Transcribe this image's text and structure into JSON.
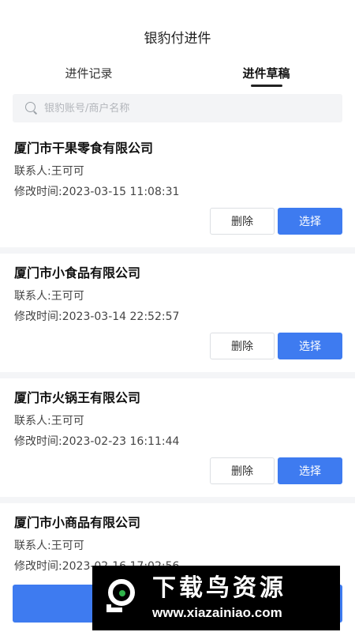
{
  "header": {
    "title": "银豹付进件"
  },
  "tabs": [
    {
      "label": "进件记录",
      "active": false
    },
    {
      "label": "进件草稿",
      "active": true
    }
  ],
  "search": {
    "placeholder": "银豹账号/商户名称",
    "value": ""
  },
  "records": [
    {
      "company": "厦门市干果零食有限公司",
      "contact": "联系人:王可可",
      "modified": "修改时间:2023-03-15 11:08:31",
      "delete_label": "删除",
      "select_label": "选择"
    },
    {
      "company": "厦门市小食品有限公司",
      "contact": "联系人:王可可",
      "modified": "修改时间:2023-03-14 22:52:57",
      "delete_label": "删除",
      "select_label": "选择"
    },
    {
      "company": "厦门市火锅王有限公司",
      "contact": "联系人:王可可",
      "modified": "修改时间:2023-02-23 16:11:44",
      "delete_label": "删除",
      "select_label": "选择"
    },
    {
      "company": "厦门市小商品有限公司",
      "contact": "联系人:王可可",
      "modified": "修改时间:2023-02-16 17:02:56"
    }
  ],
  "watermark": {
    "title": "下载鸟资源",
    "url": "www.xiazainiao.com"
  },
  "colors": {
    "accent": "#3e7bf0",
    "divider": "#f4f5f7",
    "search_bg": "#f3f4f6"
  }
}
